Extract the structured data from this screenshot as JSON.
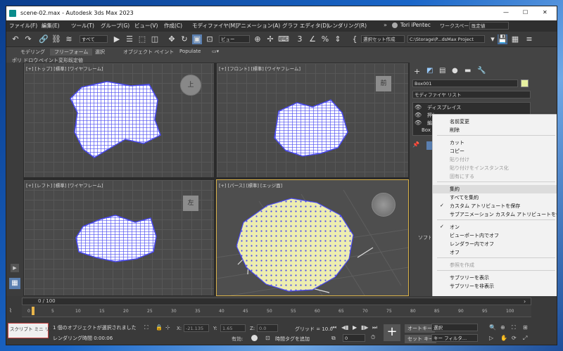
{
  "window": {
    "title": "scene-02.max - Autodesk 3ds Max 2023",
    "controls": [
      "—",
      "☐",
      "✕"
    ]
  },
  "menu": [
    "ファイル(F)",
    "編集(E)",
    "ツール(T)",
    "グループ(G)",
    "ビュー(V)",
    "作成(C)",
    "モディファイヤ(M)",
    "アニメーション(A)",
    "グラフ エディタ(D)",
    "レンダリング(R)"
  ],
  "account": {
    "user": "Tori iPentec",
    "workspace_label": "ワークスペース:",
    "workspace_value": "既定値"
  },
  "toolbar": {
    "selection_filter": "すべて",
    "ref_coord": "ビュー",
    "named_sel": "選択セット作成",
    "project_path": "C:\\Storage\\P...dsMax Project"
  },
  "ribbon": {
    "tabs": [
      "モデリング",
      "フリーフォーム",
      "選択",
      "オブジェクト ペイント",
      "Populate"
    ],
    "subtabs": [
      "ポリ ドロウ",
      "ペイント変形",
      "既定値"
    ]
  },
  "viewports": [
    {
      "label": "[+] [トップ] [標準] [ワイヤフレーム]",
      "cube": "上"
    },
    {
      "label": "[+] [フロント] [標準] [ワイヤフレーム]",
      "cube": "前"
    },
    {
      "label": "[+] [レフト] [標準] [ワイヤフレーム]",
      "cube": "左"
    },
    {
      "label": "[+] [パース] [標準] [エッジ面]",
      "cube": ""
    }
  ],
  "command_panel": {
    "object_name": "Box001",
    "modifier_list": "モディファイヤ リスト",
    "stack": [
      "ディスプレイス",
      "押し出し",
      "編集可能ポリ"
    ],
    "stack_base": "Box",
    "rollout": "ソフト選択"
  },
  "context_menu": {
    "items": [
      "名前変更",
      "削除",
      "カット",
      "コピー",
      "貼り付け",
      "貼り付けをインスタンス化",
      "固有にする",
      "集約",
      "すべてを集約",
      "カスタム アトリビュートを保存",
      "サブアニメーション カスタム アトリビュートを保持",
      "オン",
      "ビューポート内でオフ",
      "レンダラー内でオフ",
      "オフ",
      "参照を作成",
      "サブツリーを表示",
      "サブツリーを非表示"
    ],
    "disabled": [
      "貼り付け",
      "貼り付けをインスタンス化",
      "固有にする",
      "参照を作成"
    ],
    "checked": [
      "カスタム アトリビュートを保存",
      "オン"
    ]
  },
  "timeline": {
    "frame": "0 / 100",
    "ticks": [
      "0",
      "5",
      "10",
      "15",
      "20",
      "25",
      "30",
      "35",
      "40",
      "45",
      "50",
      "55",
      "60",
      "65",
      "70",
      "75",
      "80",
      "85",
      "90",
      "95",
      "100"
    ]
  },
  "status": {
    "script_label": "スクリプト ミニ リス",
    "selected": "1 個のオブジェクトが選択されました",
    "render_time": "レンダリング時間 0:00:06",
    "x_label": "X:",
    "x_value": "-21.135",
    "y_label": "Y:",
    "y_value": "1.65",
    "z_label": "Z:",
    "z_value": "0.0",
    "grid": "グリッド = 10.0",
    "enabled": "有効:",
    "add_time_tag": "時間タグを追加",
    "auto_key": "オートキー",
    "set_key": "セット キー",
    "key_mode": "選択",
    "key_filter": "キー フィルタ...",
    "frame_field": "0"
  },
  "colors": {
    "mesh_blue": "#4a4af0",
    "mesh_fill": "#ededb0",
    "context_bg": "#f2f2f2",
    "app_bg": "#444444"
  }
}
